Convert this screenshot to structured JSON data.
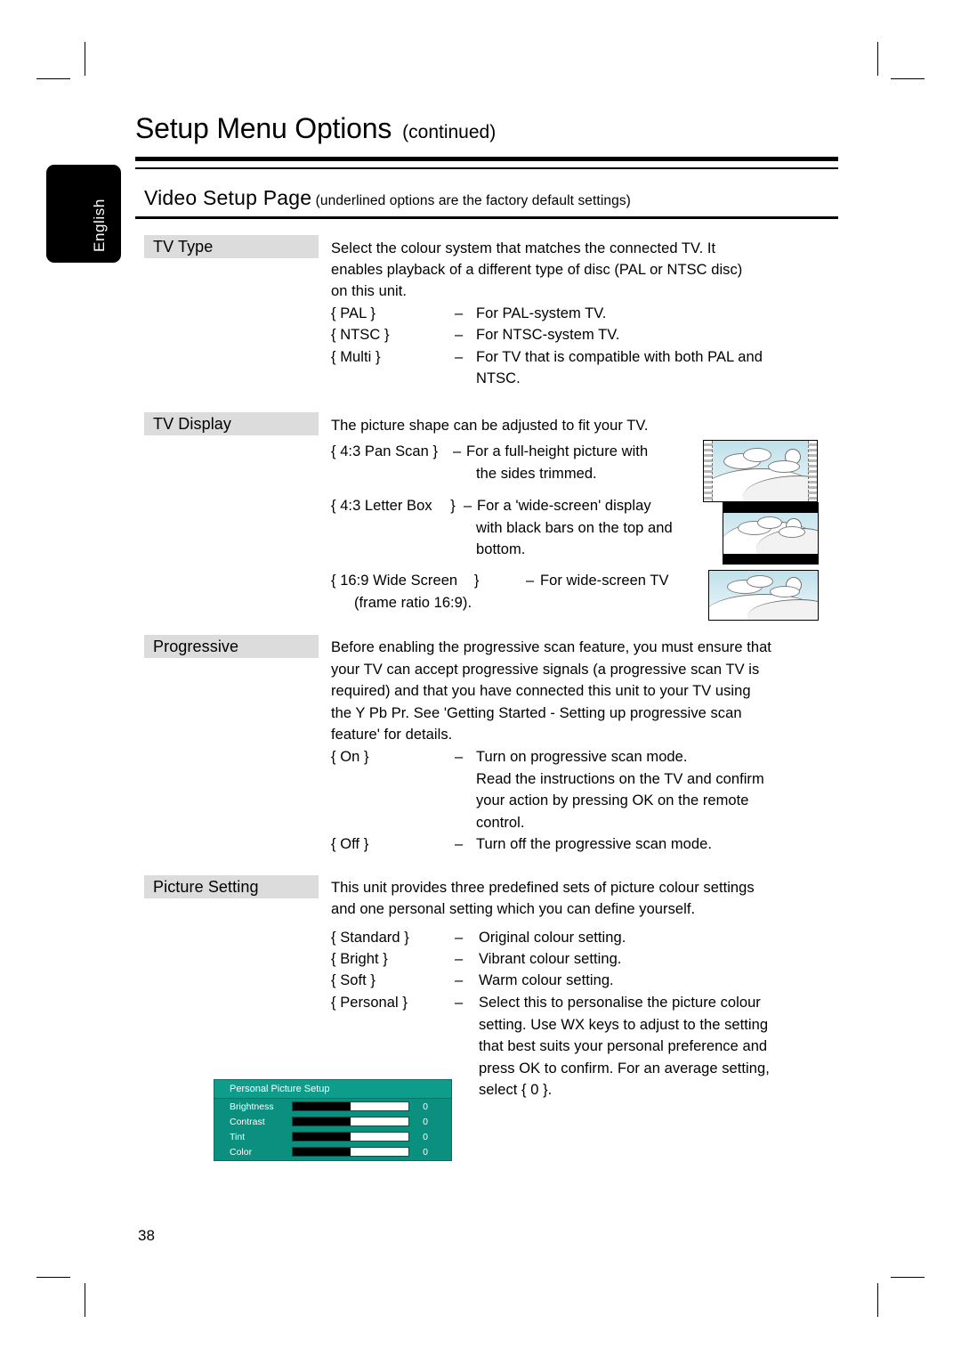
{
  "page": {
    "title": "Setup Menu Options",
    "title_continued": "(continued)",
    "language_tab": "English",
    "number": "38"
  },
  "section": {
    "title": "Video Setup Page",
    "note": "(underlined options are the factory default settings)"
  },
  "rows": {
    "tv_type": {
      "label": "TV Type",
      "intro": [
        "Select the colour system that matches the connected TV. It",
        "enables playback of a different type of disc (PAL or NTSC disc)",
        "on this unit."
      ],
      "options": [
        {
          "brace_open": "{",
          "name": "PAL",
          "brace_close": "}",
          "dash": "–",
          "desc": "For PAL-system TV.",
          "underlined": false
        },
        {
          "brace_open": "{",
          "name": "NTSC",
          "brace_close": "}",
          "dash": "–",
          "desc": "For NTSC-system TV.",
          "underlined": false
        },
        {
          "brace_open": "{",
          "name": "Multi",
          "brace_close": "}",
          "dash": "–",
          "desc": "For TV that is compatible with both PAL and",
          "desc2": "NTSC.",
          "underlined": true
        }
      ]
    },
    "tv_display": {
      "label": "TV Display",
      "intro": [
        "The picture shape can be adjusted to fit your TV."
      ],
      "options": [
        {
          "brace_open": "{",
          "name": "4:3 Pan Scan",
          "brace_close": "}",
          "dash": "–",
          "desc": "For a full-height picture with",
          "desc2": "the sides trimmed.",
          "underlined": true
        },
        {
          "brace_open": "{",
          "name": "4:3 Letter Box",
          "brace_close": "}",
          "dash": "–",
          "desc": "For a 'wide-screen' display",
          "desc2": "with black bars on the top and",
          "desc3": "bottom.",
          "underlined": false
        },
        {
          "brace_open": "{",
          "name": "16:9 Wide Screen",
          "brace_close": "}",
          "dash": "–",
          "desc": "For wide-screen TV",
          "desc2": "(frame ratio 16:9).",
          "underlined": false
        }
      ]
    },
    "progressive": {
      "label": "Progressive",
      "intro": [
        "Before enabling the progressive scan feature, you must ensure that",
        "your TV can accept progressive signals (a progressive scan TV is",
        "required) and that you have connected this unit to your TV using",
        "the Y Pb Pr. See 'Getting Started - Setting up progressive scan",
        "feature' for details."
      ],
      "options": [
        {
          "brace_open": "{",
          "name": "On",
          "brace_close": "}",
          "dash": "–",
          "desc": "Turn on progressive scan mode.",
          "desc2": "Read the instructions on the TV and confirm",
          "desc3": "your action by pressing OK on the remote",
          "desc4": "control.",
          "underlined": false
        },
        {
          "brace_open": "{",
          "name": "Off",
          "brace_close": "}",
          "dash": "–",
          "desc": "Turn off the progressive scan mode.",
          "underlined": true
        }
      ]
    },
    "picture_setting": {
      "label": "Picture Setting",
      "intro": [
        "This unit provides three predefined sets of picture colour settings",
        "and one personal setting which you can define yourself."
      ],
      "options": [
        {
          "brace_open": "{",
          "name": "Standard",
          "brace_close": "}",
          "dash": "–",
          "desc": "Original colour setting.",
          "underlined": true
        },
        {
          "brace_open": "{",
          "name": "Bright",
          "brace_close": "}",
          "dash": "–",
          "desc": "Vibrant colour setting.",
          "underlined": false
        },
        {
          "brace_open": "{",
          "name": "Soft",
          "brace_close": "}",
          "dash": "–",
          "desc": "Warm colour setting.",
          "underlined": false
        },
        {
          "brace_open": "{",
          "name": "Personal",
          "brace_close": "}",
          "dash": "–",
          "desc": "Select this to personalise the picture colour",
          "desc2": "setting. Use  WX keys to adjust to the setting",
          "desc3": "that best suits your personal preference and",
          "desc4": "press OK to confirm. For an average setting,",
          "desc5": "select { 0 }.",
          "underlined": false
        }
      ]
    }
  },
  "osd": {
    "title": "Personal Picture Setup",
    "rows": [
      {
        "name": "Brightness",
        "value": "0",
        "fill_percent": 50
      },
      {
        "name": "Contrast",
        "value": "0",
        "fill_percent": 50
      },
      {
        "name": "Tint",
        "value": "0",
        "fill_percent": 50
      },
      {
        "name": "Color",
        "value": "0",
        "fill_percent": 50
      }
    ]
  }
}
